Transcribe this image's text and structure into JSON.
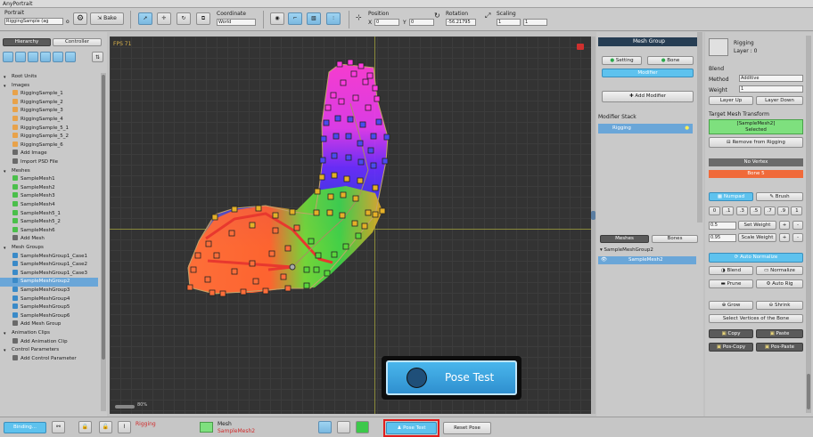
{
  "app": {
    "title": "AnyPortrait"
  },
  "toolbar": {
    "portrait_label": "Portrait",
    "portrait_value": "RiggingSample (ag",
    "portrait_o": "o",
    "bake_label": "Bake",
    "coordinate_label": "Coordinate",
    "coordinate_value": "World",
    "position_label": "Position",
    "pos_x_label": "X",
    "pos_x": "0",
    "pos_y_label": "Y",
    "pos_y": "0",
    "rotation_label": "Rotation",
    "rotation_value": "-56.21795",
    "scaling_label": "Scaling",
    "scale_x": "1",
    "scale_y": "1"
  },
  "left": {
    "tab_hierarchy": "Hierarchy",
    "tab_controller": "Controller",
    "rows": [
      {
        "text": "Root Units",
        "type": "section"
      },
      {
        "text": "Images",
        "type": "section"
      },
      {
        "text": "RiggingSample_1",
        "type": "image"
      },
      {
        "text": "RiggingSample_2",
        "type": "image"
      },
      {
        "text": "RiggingSample_3",
        "type": "image"
      },
      {
        "text": "RiggingSample_4",
        "type": "image"
      },
      {
        "text": "RiggingSample_5_1",
        "type": "image"
      },
      {
        "text": "RiggingSample_5_2",
        "type": "image"
      },
      {
        "text": "RiggingSample_6",
        "type": "image"
      },
      {
        "text": "Add Image",
        "type": "add"
      },
      {
        "text": "Import PSD File",
        "type": "add"
      },
      {
        "text": "Meshes",
        "type": "section"
      },
      {
        "text": "SampleMesh1",
        "type": "mesh"
      },
      {
        "text": "SampleMesh2",
        "type": "mesh"
      },
      {
        "text": "SampleMesh3",
        "type": "mesh"
      },
      {
        "text": "SampleMesh4",
        "type": "mesh"
      },
      {
        "text": "SampleMesh5_1",
        "type": "mesh"
      },
      {
        "text": "SampleMesh5_2",
        "type": "mesh"
      },
      {
        "text": "SampleMesh6",
        "type": "mesh"
      },
      {
        "text": "Add Mesh",
        "type": "add"
      },
      {
        "text": "Mesh Groups",
        "type": "section"
      },
      {
        "text": "SampleMeshGroup1_Case1",
        "type": "group"
      },
      {
        "text": "SampleMeshGroup1_Case2",
        "type": "group"
      },
      {
        "text": "SampleMeshGroup1_Case3",
        "type": "group"
      },
      {
        "text": "SampleMeshGroup2",
        "type": "group",
        "selected": true
      },
      {
        "text": "SampleMeshGroup3",
        "type": "group"
      },
      {
        "text": "SampleMeshGroup4",
        "type": "group"
      },
      {
        "text": "SampleMeshGroup5",
        "type": "group"
      },
      {
        "text": "SampleMeshGroup6",
        "type": "group"
      },
      {
        "text": "Add Mesh Group",
        "type": "add"
      },
      {
        "text": "Animation Clips",
        "type": "section"
      },
      {
        "text": "Add Animation Clip",
        "type": "add"
      },
      {
        "text": "Control Parameters",
        "type": "section"
      },
      {
        "text": "Add Control Parameter",
        "type": "add"
      }
    ]
  },
  "viewport": {
    "fps": "FPS 71",
    "zoom": "80%",
    "pose_test": "Pose Test"
  },
  "mid": {
    "header": "Mesh Group",
    "setting": "Setting",
    "bone": "Bone",
    "modifier": "Modifier",
    "add_modifier": "Add Modifier",
    "modifier_stack": "Modifier Stack",
    "rigging": "Rigging",
    "tab_meshes": "Meshes",
    "tab_bones": "Bones",
    "tree_group": "SampleMeshGroup2",
    "tree_mesh": "SampleMesh2"
  },
  "right": {
    "title": "Rigging",
    "layer": "Layer : 0",
    "blend_label": "Blend",
    "method_label": "Method",
    "method_value": "Additive",
    "weight_label": "Weight",
    "weight_value": "1",
    "layer_up": "Layer Up",
    "layer_down": "Layer Down",
    "target_label": "Target Mesh Transform",
    "target_name": "[SampleMesh2]",
    "target_status": "Selected",
    "remove_rigging": "Remove from Rigging",
    "no_vertex": "No Vertex",
    "bone_name": "Bone 5",
    "numpad": "Numpad",
    "brush": "Brush",
    "nums": [
      "0",
      ".1",
      ".3",
      ".5",
      ".7",
      ".9",
      "1"
    ],
    "set_weight_value": "0.5",
    "set_weight": "Set Weight",
    "scale_weight_value": "0.95",
    "scale_weight": "Scale Weight",
    "plus": "+",
    "minus": "-",
    "auto_normalize": "Auto Normalize",
    "blend": "Blend",
    "normalize": "Normalize",
    "prune": "Prune",
    "auto_rig": "Auto Rig",
    "grow": "Grow",
    "shrink": "Shrink",
    "select_vertices": "Select Vertices of the Bone",
    "copy": "Copy",
    "paste": "Paste",
    "pos_copy": "Pos-Copy",
    "pos_paste": "Pos-Paste"
  },
  "bottom": {
    "binding": "Binding...",
    "rigging_label": "Rigging",
    "mesh_label": "Mesh",
    "mesh_value": "SampleMesh2",
    "pose_test": "Pose Test",
    "reset_pose": "Reset Pose"
  }
}
